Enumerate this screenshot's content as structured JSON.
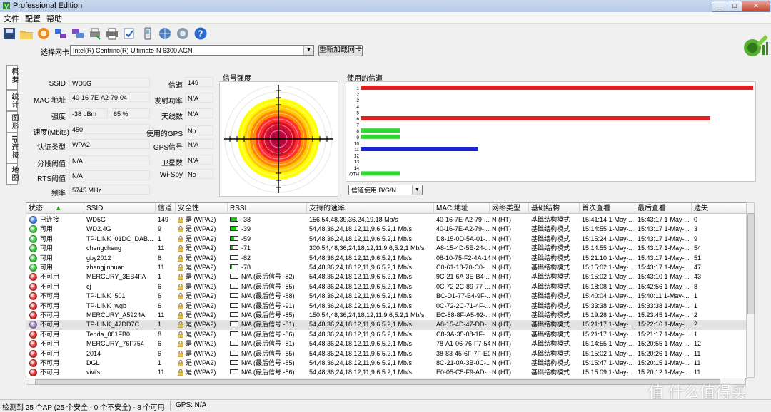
{
  "window": {
    "title": "Professional Edition"
  },
  "menu": [
    "文件",
    "配置",
    "帮助"
  ],
  "toolbar_icons": [
    "save-icon",
    "open-folder-icon",
    "record-icon",
    "network-icon",
    "export-icon",
    "print-icon",
    "printer-icon",
    "settings-icon",
    "gps-icon",
    "globe-icon",
    "help-icon",
    "question-icon"
  ],
  "adapter": {
    "label": "选择网卡",
    "value": "Intel(R) Centrino(R) Ultimate-N 6300 AGN",
    "reload_button": "重新加载网卡"
  },
  "side_tabs": [
    "概要",
    "统计",
    "图形",
    "IP连接",
    "地图"
  ],
  "info": {
    "ssid": {
      "label": "SSID",
      "value": "WD5G"
    },
    "mac": {
      "label": "MAC 地址",
      "value": "40-16-7E-A2-79-04"
    },
    "strength": {
      "label": "强度",
      "dbm": "-38 dBm",
      "pct": "65 %"
    },
    "rate": {
      "label": "速度(Mbits)",
      "value": "450"
    },
    "auth": {
      "label": "认证类型",
      "value": "WPA2"
    },
    "frag": {
      "label": "分段阈值",
      "value": "N/A"
    },
    "rts": {
      "label": "RTS阈值",
      "value": "N/A"
    },
    "freq": {
      "label": "频率",
      "value": "5745 MHz"
    },
    "channel": {
      "label": "信道",
      "value": "149"
    },
    "txpower": {
      "label": "发射功率",
      "value": "N/A"
    },
    "antenna": {
      "label": "天线数",
      "value": "N/A"
    },
    "gps_used": {
      "label": "使用的GPS",
      "value": "No"
    },
    "gps_signal": {
      "label": "GPS信号",
      "value": "N/A"
    },
    "satellites": {
      "label": "卫星数",
      "value": "N/A"
    },
    "wispy": {
      "label": "Wi-Spy",
      "value": "No"
    }
  },
  "signal_chart": {
    "title": "信号强度"
  },
  "channel_chart": {
    "title": "使用的信道",
    "labels": [
      "1",
      "2",
      "3",
      "4",
      "5",
      "6",
      "7",
      "8",
      "9",
      "10",
      "11",
      "12",
      "13",
      "14",
      "OTH"
    ],
    "bars": [
      {
        "channel": "1",
        "value": 1.0,
        "color": "#e02020"
      },
      {
        "channel": "6",
        "value": 0.89,
        "color": "#e02020"
      },
      {
        "channel": "8",
        "value": 0.1,
        "color": "#2fd62f"
      },
      {
        "channel": "9",
        "value": 0.1,
        "color": "#2fd62f"
      },
      {
        "channel": "11",
        "value": 0.3,
        "color": "#1c22d6"
      },
      {
        "channel": "OTH",
        "value": 0.1,
        "color": "#2fd62f"
      }
    ],
    "mode_select": "信道使用 B/G/N"
  },
  "table": {
    "columns": [
      "状态",
      "SSID",
      "信道",
      "安全性",
      "RSSI",
      "支持的速率",
      "MAC 地址",
      "网络类型",
      "基础结构",
      "首次查看",
      "最后查看",
      "遗失"
    ],
    "rows": [
      {
        "color": "#3b78d8",
        "status": "已连接",
        "ssid": "WD5G",
        "ch": "149",
        "sec": "是 (WPA2)",
        "rssi": "-38",
        "rfill": 0.85,
        "rate": "156,54,48,39,36,24,19,18 Mb/s",
        "mac": "40-16-7E-A2-79-...",
        "net": "N (HT)",
        "infra": "基础结构模式",
        "first": "15:41:14 1-May-...",
        "last": "15:43:17 1-May-...",
        "lost": "0"
      },
      {
        "color": "#3cc43c",
        "status": "可用",
        "ssid": "WD2.4G",
        "ch": "9",
        "sec": "是 (WPA2)",
        "rssi": "-39",
        "rfill": 0.8,
        "rate": "54,48,36,24,18,12,11,9,6,5.2,1 Mb/s",
        "mac": "40-16-7E-A2-79-...",
        "net": "N (HT)",
        "infra": "基础结构模式",
        "first": "15:14:55 1-May-...",
        "last": "15:43:17 1-May-...",
        "lost": "3"
      },
      {
        "color": "#3cc43c",
        "status": "可用",
        "ssid": "TP-LINK_01DC_DAB...",
        "ch": "1",
        "sec": "是 (WPA2)",
        "rssi": "-59",
        "rfill": 0.5,
        "rate": "54,48,36,24,18,12,11,9,6,5.2,1 Mb/s",
        "mac": "D8-15-0D-5A-01-...",
        "net": "N (HT)",
        "infra": "基础结构模式",
        "first": "15:15:24 1-May-...",
        "last": "15:43:17 1-May-...",
        "lost": "9"
      },
      {
        "color": "#3cc43c",
        "status": "可用",
        "ssid": "chengcheng",
        "ch": "11",
        "sec": "是 (WPA2)",
        "rssi": "-71",
        "rfill": 0.3,
        "rate": "300,54,48,36,24,18,12,11,9,6,5.2,1 Mb/s",
        "mac": "A8-15-4D-5E-24-...",
        "net": "N (HT)",
        "infra": "基础结构模式",
        "first": "15:14:55 1-May-...",
        "last": "15:43:17 1-May-...",
        "lost": "54"
      },
      {
        "color": "#3cc43c",
        "status": "可用",
        "ssid": "gby2012",
        "ch": "6",
        "sec": "是 (WPA2)",
        "rssi": "-82",
        "rfill": 0.12,
        "rate": "54,48,36,24,18,12,11,9,6,5.2,1 Mb/s",
        "mac": "08-10-75-F2-4A-14",
        "net": "N (HT)",
        "infra": "基础结构模式",
        "first": "15:21:10 1-May-...",
        "last": "15:43:17 1-May-...",
        "lost": "51"
      },
      {
        "color": "#3cc43c",
        "status": "可用",
        "ssid": "zhangjinhuan",
        "ch": "11",
        "sec": "是 (WPA2)",
        "rssi": "-78",
        "rfill": 0.18,
        "rate": "54,48,36,24,18,12,11,9,6,5.2,1 Mb/s",
        "mac": "C0-61-18-70-C0-...",
        "net": "N (HT)",
        "infra": "基础结构模式",
        "first": "15:15:02 1-May-...",
        "last": "15:43:17 1-May-...",
        "lost": "47"
      },
      {
        "color": "#d83030",
        "status": "不可用",
        "ssid": "MERCURY_3EB4FA",
        "ch": "1",
        "sec": "是 (WPA2)",
        "rssi": "N/A (最后信号 -82)",
        "rfill": 0,
        "rate": "54,48,36,24,18,12,11,9,6,5.2,1 Mb/s",
        "mac": "9C-21-6A-3E-B4-...",
        "net": "N (HT)",
        "infra": "基础结构模式",
        "first": "15:15:02 1-May-...",
        "last": "15:43:10 1-May-...",
        "lost": "43"
      },
      {
        "color": "#d83030",
        "status": "不可用",
        "ssid": "cj",
        "ch": "6",
        "sec": "是 (WPA2)",
        "rssi": "N/A (最后信号 -85)",
        "rfill": 0,
        "rate": "54,48,36,24,18,12,11,9,6,5.2,1 Mb/s",
        "mac": "0C-72-2C-89-77-...",
        "net": "N (HT)",
        "infra": "基础结构模式",
        "first": "15:18:08 1-May-...",
        "last": "15:42:56 1-May-...",
        "lost": "8"
      },
      {
        "color": "#d83030",
        "status": "不可用",
        "ssid": "TP-LINK_501",
        "ch": "6",
        "sec": "是 (WPA2)",
        "rssi": "N/A (最后信号 -88)",
        "rfill": 0,
        "rate": "54,48,36,24,18,12,11,9,6,5.2,1 Mb/s",
        "mac": "BC-D1-77-B4-9F-...",
        "net": "N (HT)",
        "infra": "基础结构模式",
        "first": "15:40:04 1-May-...",
        "last": "15:40:11 1-May-...",
        "lost": "1"
      },
      {
        "color": "#d83030",
        "status": "不可用",
        "ssid": "TP-LINK_wgb",
        "ch": "6",
        "sec": "是 (WPA2)",
        "rssi": "N/A (最后信号 -91)",
        "rfill": 0,
        "rate": "54,48,36,24,18,12,11,9,6,5.2,1 Mb/s",
        "mac": "0C-72-2C-71-4F-...",
        "net": "N (HT)",
        "infra": "基础结构模式",
        "first": "15:33:38 1-May-...",
        "last": "15:33:38 1-May-...",
        "lost": "1"
      },
      {
        "color": "#d83030",
        "status": "不可用",
        "ssid": "MERCURY_A5924A",
        "ch": "11",
        "sec": "是 (WPA2)",
        "rssi": "N/A (最后信号 -85)",
        "rfill": 0,
        "rate": "150,54,48,36,24,18,12,11,9,6,5.2,1 Mb/s",
        "mac": "EC-88-8F-A5-92-...",
        "net": "N (HT)",
        "infra": "基础结构模式",
        "first": "15:19:28 1-May-...",
        "last": "15:23:45 1-May-...",
        "lost": "2"
      },
      {
        "color": "#9a7fb8",
        "status": "不可用",
        "ssid": "TP-LINK_47DD7C",
        "ch": "1",
        "sec": "是 (WPA2)",
        "rssi": "N/A (最后信号 -81)",
        "rfill": 0,
        "rate": "54,48,36,24,18,12,11,9,6,5.2,1 Mb/s",
        "mac": "A8-15-4D-47-DD-...",
        "net": "N (HT)",
        "infra": "基础结构模式",
        "first": "15:21:17 1-May-...",
        "last": "15:22:16 1-May-...",
        "lost": "2",
        "selected": true
      },
      {
        "color": "#d83030",
        "status": "不可用",
        "ssid": "Tenda_081FB0",
        "ch": "8",
        "sec": "是 (WPA2)",
        "rssi": "N/A (最后信号 -86)",
        "rfill": 0,
        "rate": "54,48,36,24,18,12,11,9,6,5.2,1 Mb/s",
        "mac": "C8-3A-35-08-1F-...",
        "net": "N (HT)",
        "infra": "基础结构模式",
        "first": "15:21:17 1-May-...",
        "last": "15:21:17 1-May-...",
        "lost": "1"
      },
      {
        "color": "#d83030",
        "status": "不可用",
        "ssid": "MERCURY_76F754",
        "ch": "6",
        "sec": "是 (WPA2)",
        "rssi": "N/A (最后信号 -81)",
        "rfill": 0,
        "rate": "54,48,36,24,18,12,11,9,6,5.2,1 Mb/s",
        "mac": "78-A1-06-76-F7-54",
        "net": "N (HT)",
        "infra": "基础结构模式",
        "first": "15:14:55 1-May-...",
        "last": "15:20:55 1-May-...",
        "lost": "12"
      },
      {
        "color": "#d83030",
        "status": "不可用",
        "ssid": "2014",
        "ch": "6",
        "sec": "是 (WPA2)",
        "rssi": "N/A (最后信号 -85)",
        "rfill": 0,
        "rate": "54,48,36,24,18,12,11,9,6,5.2,1 Mb/s",
        "mac": "38-83-45-6F-7F-E0",
        "net": "N (HT)",
        "infra": "基础结构模式",
        "first": "15:15:02 1-May-...",
        "last": "15:20:26 1-May-...",
        "lost": "11"
      },
      {
        "color": "#d83030",
        "status": "不可用",
        "ssid": "DGL",
        "ch": "1",
        "sec": "是 (WPA2)",
        "rssi": "N/A (最后信号 -85)",
        "rfill": 0,
        "rate": "54,48,36,24,18,12,11,9,6,5.2,1 Mb/s",
        "mac": "8C-21-0A-3B-0C-...",
        "net": "N (HT)",
        "infra": "基础结构模式",
        "first": "15:15:47 1-May-...",
        "last": "15:20:15 1-May-...",
        "lost": "11"
      },
      {
        "color": "#d83030",
        "status": "不可用",
        "ssid": "vivi's",
        "ch": "11",
        "sec": "是 (WPA2)",
        "rssi": "N/A (最后信号 -86)",
        "rfill": 0,
        "rate": "54,48,36,24,18,12,11,9,6,5.2,1 Mb/s",
        "mac": "E0-05-C5-F9-AD-...",
        "net": "N (HT)",
        "infra": "基础结构模式",
        "first": "15:15:09 1-May-...",
        "last": "15:20:12 1-May-...",
        "lost": "11"
      }
    ]
  },
  "status": {
    "left": "检测到 25 个AP (25 个安全 - 0 个不安全) - 8 个可用",
    "gps": "GPS: N/A"
  },
  "watermark": "值 什么值得买"
}
